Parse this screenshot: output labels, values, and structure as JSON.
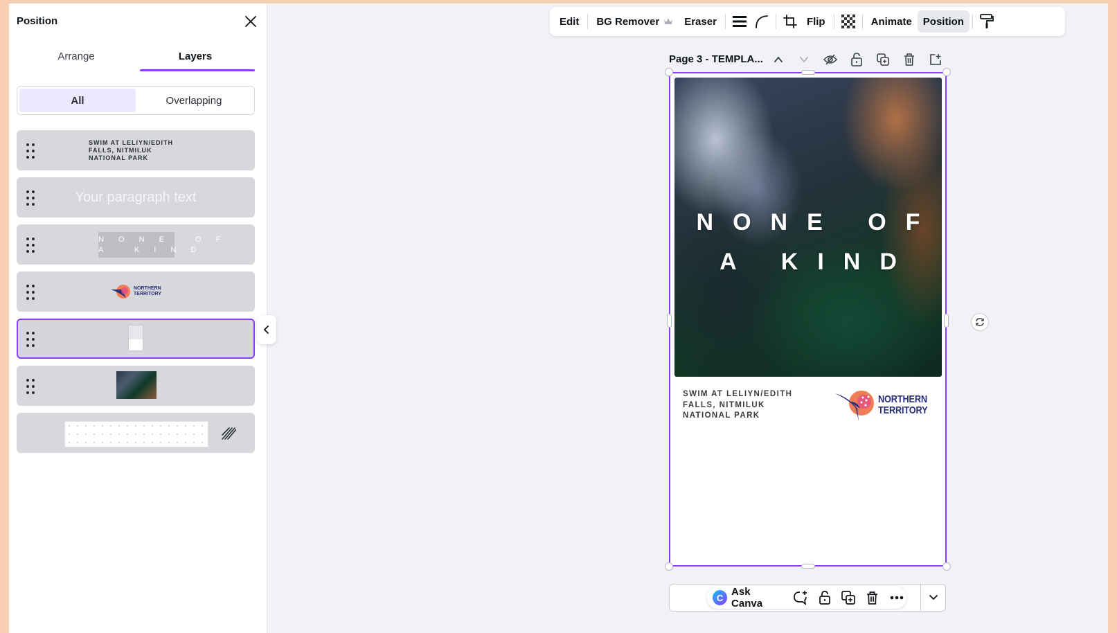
{
  "panel": {
    "title": "Position",
    "tabs": [
      {
        "label": "Arrange"
      },
      {
        "label": "Layers"
      }
    ],
    "filters": [
      {
        "label": "All"
      },
      {
        "label": "Overlapping"
      }
    ],
    "layers": [
      {
        "type": "text",
        "lines": [
          "SWIM AT LELIYN/EDITH",
          "FALLS, NITMILUK",
          "NATIONAL PARK"
        ]
      },
      {
        "type": "text",
        "text": "Your paragraph text"
      },
      {
        "type": "text",
        "lines": [
          "N O N E   O F",
          "A   K I N D"
        ]
      },
      {
        "type": "logo",
        "lines": [
          "NORTHERN",
          "TERRITORY"
        ]
      },
      {
        "type": "shape",
        "selected": true
      },
      {
        "type": "photo"
      },
      {
        "type": "background"
      }
    ]
  },
  "toolbar": {
    "edit": "Edit",
    "bg_remover": "BG Remover",
    "eraser": "Eraser",
    "flip": "Flip",
    "animate": "Animate",
    "position": "Position"
  },
  "page": {
    "title": "Page 3 - TEMPLA...",
    "headline_1": "NONE OF",
    "headline_2": "A KIND",
    "caption": [
      "SWIM AT LELIYN/EDITH",
      "FALLS, NITMILUK",
      "NATIONAL PARK"
    ],
    "logo": [
      "NORTHERN",
      "TERRITORY"
    ]
  },
  "bottom_bar": {
    "ask_canva": "Ask Canva",
    "ask_logo_letter": "C"
  },
  "colors": {
    "accent": "#8b3dff",
    "logo_navy": "#2a2e7a",
    "logo_orange": "#f07d55",
    "logo_pink": "#e44d8a"
  }
}
